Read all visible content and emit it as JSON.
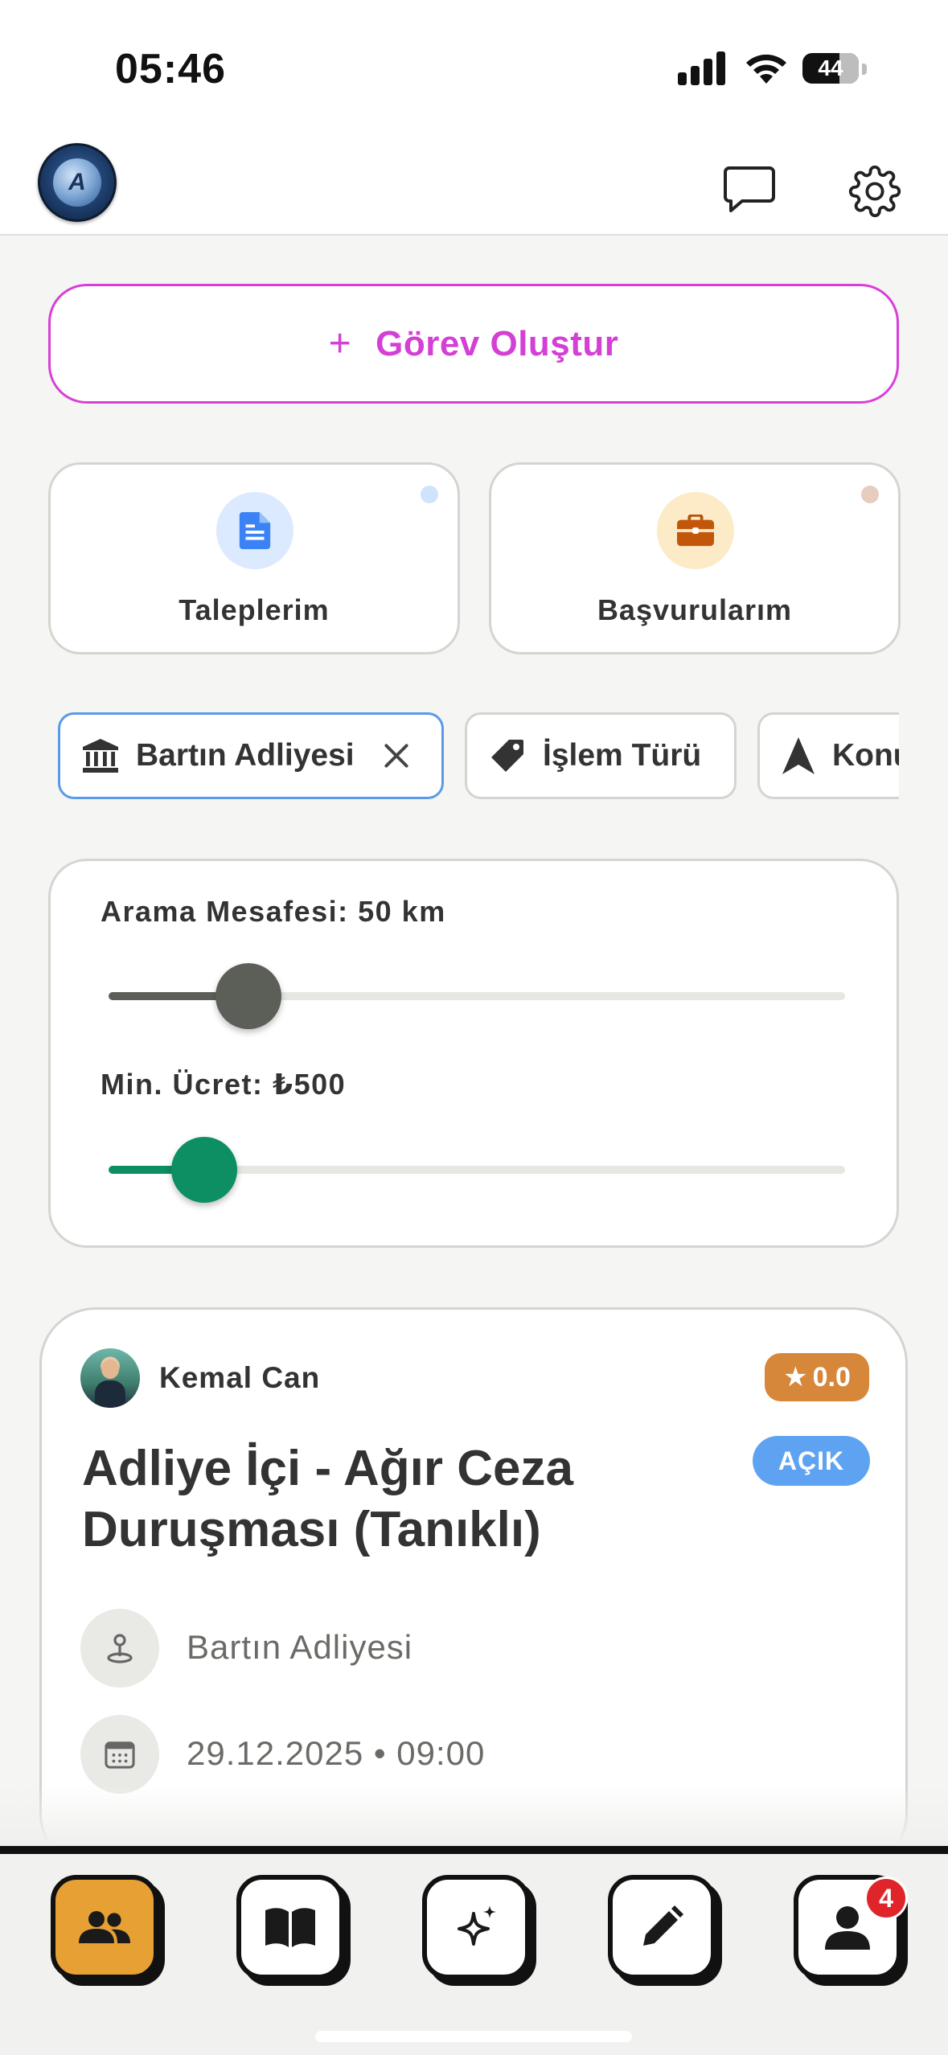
{
  "status_bar": {
    "time": "05:46",
    "battery": "44"
  },
  "header": {
    "logo_icon": "app-logo",
    "chat_icon": "chat-bubble-icon",
    "settings_icon": "gear-icon"
  },
  "create_task": {
    "plus": "+",
    "label": "Görev Oluştur",
    "color": "#d43fd6"
  },
  "quick_cards": [
    {
      "label": "Taleplerim",
      "icon": "document-icon",
      "dot_color": "#cfe3fb"
    },
    {
      "label": "Başvurularım",
      "icon": "briefcase-icon",
      "dot_color": "#e7cdbf"
    }
  ],
  "filters": [
    {
      "label": "Bartın Adliyesi",
      "icon": "courthouse-icon",
      "active": true,
      "clear_icon": "close-icon"
    },
    {
      "label": "İşlem Türü",
      "icon": "tag-icon",
      "active": false
    },
    {
      "label": "Konum",
      "icon": "navigation-arrow-icon",
      "active": false
    }
  ],
  "sliders": {
    "distance": {
      "label": "Arama Mesafesi: 50 km",
      "value_fraction": 0.19,
      "color": "#5c5e58"
    },
    "min_fee": {
      "label": "Min. Ücret: ₺500",
      "value_fraction": 0.13,
      "color": "#0e8f63"
    }
  },
  "task": {
    "poster": "Kemal Can",
    "rating": "0.0",
    "rating_star": "★",
    "status": "AÇIK",
    "title": "Adliye İçi - Ağır Ceza Duruşması (Tanıklı)",
    "location": "Bartın Adliyesi",
    "datetime": "29.12.2025 • 09:00"
  },
  "bottom_nav": {
    "items": [
      {
        "icon": "people-icon",
        "active": true
      },
      {
        "icon": "book-icon",
        "active": false
      },
      {
        "icon": "sparkle-icon",
        "active": false
      },
      {
        "icon": "pencil-icon",
        "active": false
      },
      {
        "icon": "profile-icon",
        "active": false
      }
    ],
    "profile_badge": "4"
  }
}
